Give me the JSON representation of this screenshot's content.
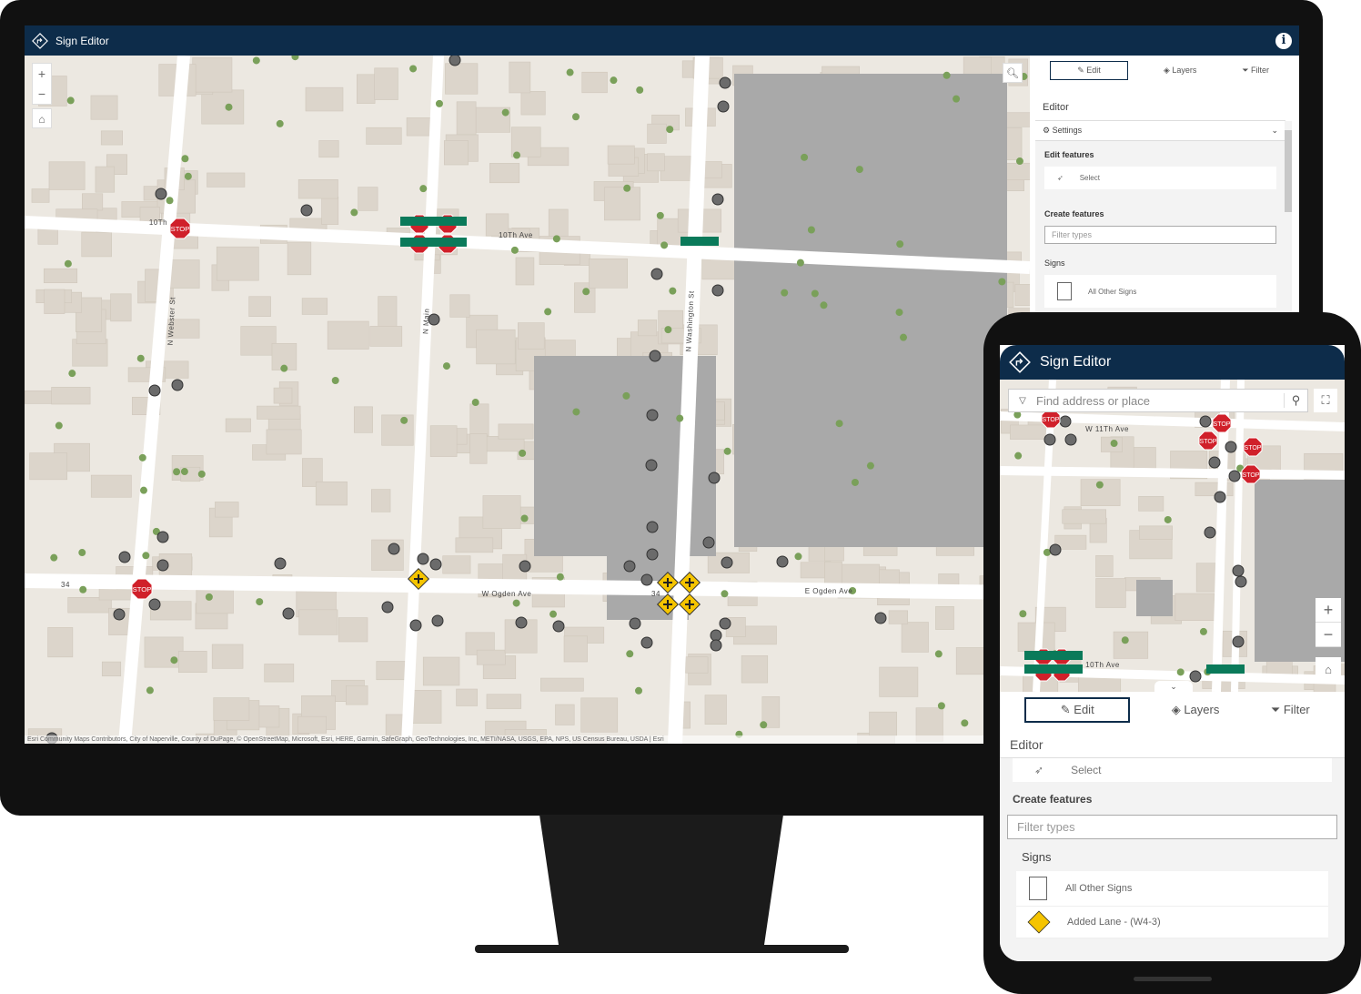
{
  "app": {
    "title": "Sign Editor",
    "info_icon": "info-icon",
    "header_color": "#0d2c4a"
  },
  "desktop": {
    "map": {
      "zoom_in": "+",
      "zoom_out": "−",
      "attribution": "Esri Community Maps Contributors, City of Naperville, County of DuPage, © OpenStreetMap, Microsoft, Esri, HERE, Garmin, SafeGraph, GeoTechnologies, Inc, METI/NASA, USGS, EPA, NPS, US Census Bureau, USDA | Esri",
      "streets": {
        "tenth_left": "10Th",
        "tenth": "10Th Ave",
        "ogden_w": "W Ogden Ave",
        "ogden_e": "E Ogden Ave",
        "webster": "N Webster St",
        "main": "N Main",
        "washington": "N Washington St",
        "route_shield": "34"
      },
      "stop_label": "STOP"
    },
    "panel": {
      "tabs": [
        {
          "label": "Edit",
          "icon": "edit-icon",
          "active": true
        },
        {
          "label": "Layers",
          "icon": "layers-icon"
        },
        {
          "label": "Filter",
          "icon": "filter-icon"
        }
      ],
      "title": "Editor",
      "settings": "Settings",
      "edit_features": "Edit features",
      "select": "Select",
      "create_features": "Create features",
      "filter_placeholder": "Filter types",
      "group": "Signs",
      "items": [
        "All Other Signs"
      ]
    }
  },
  "mobile": {
    "search_placeholder": "Find address or place",
    "map": {
      "street_11th": "W 11Th Ave",
      "street_10th": "10Th Ave",
      "stop_label": "STOP"
    },
    "panel": {
      "tabs": [
        {
          "label": "Edit",
          "active": true
        },
        {
          "label": "Layers"
        },
        {
          "label": "Filter"
        }
      ],
      "title": "Editor",
      "select": "Select",
      "create_features": "Create features",
      "filter_placeholder": "Filter types",
      "group": "Signs",
      "items": [
        "All Other Signs",
        "Added Lane - (W4-3)"
      ]
    }
  },
  "colors": {
    "stop": "#d0202a",
    "warning": "#f5c400",
    "guide": "#0a7a5a",
    "point": "#6b6b6b",
    "road": "#ffffff",
    "ground": "#ece8e1",
    "building": "#dcd5cb",
    "parking": "#a9a9a9"
  }
}
